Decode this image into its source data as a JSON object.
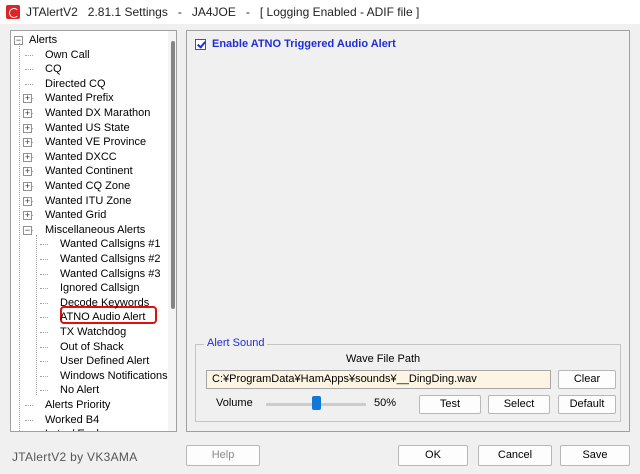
{
  "window": {
    "title_app": "JTAlertV2",
    "title_version": "2.81.1 Settings",
    "title_sep": "-",
    "title_call": "JA4JOE",
    "title_status": "[ Logging Enabled - ADIF file ]"
  },
  "tree": {
    "items": [
      {
        "label": "Alerts",
        "level": 0,
        "expander": "minus"
      },
      {
        "label": "Own Call",
        "level": 1
      },
      {
        "label": "CQ",
        "level": 1
      },
      {
        "label": "Directed CQ",
        "level": 1
      },
      {
        "label": "Wanted Prefix",
        "level": 1,
        "expander": "plus"
      },
      {
        "label": "Wanted DX Marathon",
        "level": 1,
        "expander": "plus"
      },
      {
        "label": "Wanted US State",
        "level": 1,
        "expander": "plus"
      },
      {
        "label": "Wanted VE Province",
        "level": 1,
        "expander": "plus"
      },
      {
        "label": "Wanted DXCC",
        "level": 1,
        "expander": "plus"
      },
      {
        "label": "Wanted Continent",
        "level": 1,
        "expander": "plus"
      },
      {
        "label": "Wanted CQ Zone",
        "level": 1,
        "expander": "plus"
      },
      {
        "label": "Wanted ITU Zone",
        "level": 1,
        "expander": "plus"
      },
      {
        "label": "Wanted Grid",
        "level": 1,
        "expander": "plus"
      },
      {
        "label": "Miscellaneous Alerts",
        "level": 1,
        "expander": "minus"
      },
      {
        "label": "Wanted Callsigns #1",
        "level": 2
      },
      {
        "label": "Wanted Callsigns #2",
        "level": 2
      },
      {
        "label": "Wanted Callsigns #3",
        "level": 2
      },
      {
        "label": "Ignored Callsign",
        "level": 2
      },
      {
        "label": "Decode Keywords",
        "level": 2
      },
      {
        "label": "ATNO Audio Alert",
        "level": 2,
        "selected": true
      },
      {
        "label": "TX Watchdog",
        "level": 2
      },
      {
        "label": "Out of Shack",
        "level": 2
      },
      {
        "label": "User Defined Alert",
        "level": 2
      },
      {
        "label": "Windows Notifications",
        "level": 2
      },
      {
        "label": "No Alert",
        "level": 2
      },
      {
        "label": "Alerts Priority",
        "level": 1
      },
      {
        "label": "Worked B4",
        "level": 1
      },
      {
        "label": "Lotw / Eqsl",
        "level": 1
      }
    ]
  },
  "content": {
    "enable_label": "Enable ATNO Triggered Audio Alert",
    "enable_checked": true,
    "alert_sound": {
      "group_title": "Alert Sound",
      "wav_label": "Wave File Path",
      "wav_path": "C:¥ProgramData¥HamApps¥sounds¥__DingDing.wav",
      "clear_label": "Clear",
      "volume_label": "Volume",
      "volume_value": "50%",
      "volume_level": 0.5,
      "test_label": "Test",
      "select_label": "Select",
      "default_label": "Default"
    }
  },
  "footer": {
    "credit": "JTAlertV2 by VK3AMA",
    "help_label": "Help",
    "ok_label": "OK",
    "cancel_label": "Cancel",
    "save_label": "Save"
  },
  "colors": {
    "accent_blue": "#1f2dd6",
    "highlight_red": "#e01010",
    "input_bg": "#fdf5e3"
  }
}
